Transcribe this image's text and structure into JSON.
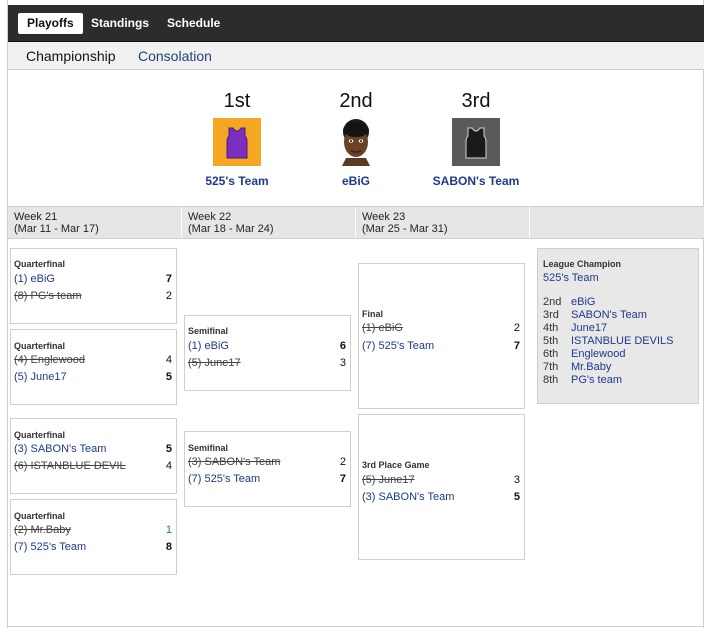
{
  "topnav": {
    "tabs": [
      "Playoffs",
      "Standings",
      "Schedule"
    ],
    "active": 0
  },
  "subnav": {
    "tabs": [
      "Championship",
      "Consolation"
    ],
    "active": 0
  },
  "podium": [
    {
      "place": "1st",
      "team": "525's Team",
      "icon": "purple-jersey-icon",
      "color": "#7b2fbf"
    },
    {
      "place": "2nd",
      "team": "eBiG",
      "icon": "player-portrait-icon",
      "color": "#5a3a22"
    },
    {
      "place": "3rd",
      "team": "SABON's Team",
      "icon": "black-jersey-icon",
      "color": "#1a1a1a"
    }
  ],
  "weeks": [
    {
      "week": "Week 21",
      "dates": "(Mar 11 - Mar 17)"
    },
    {
      "week": "Week 22",
      "dates": "(Mar 18 - Mar 24)"
    },
    {
      "week": "Week 23",
      "dates": "(Mar 25 - Mar 31)"
    }
  ],
  "bracket": {
    "quarterfinals": [
      {
        "round": "Quarterfinal",
        "a": {
          "team": "(1) eBiG",
          "score": "7",
          "lost": false
        },
        "b": {
          "team": "(8) PG's team",
          "score": "2",
          "lost": true
        }
      },
      {
        "round": "Quarterfinal",
        "a": {
          "team": "(4) Englewood",
          "score": "4",
          "lost": true
        },
        "b": {
          "team": "(5) June17",
          "score": "5",
          "lost": false
        }
      },
      {
        "round": "Quarterfinal",
        "a": {
          "team": "(3) SABON's Team",
          "score": "5",
          "lost": false
        },
        "b": {
          "team": "(6) ISTANBLUE DEVIL",
          "score": "4",
          "lost": true
        }
      },
      {
        "round": "Quarterfinal",
        "a": {
          "team": "(2) Mr.Baby",
          "score": "1",
          "lost": true
        },
        "b": {
          "team": "(7) 525's Team",
          "score": "8",
          "lost": false
        }
      }
    ],
    "semifinals": [
      {
        "round": "Semifinal",
        "a": {
          "team": "(1) eBiG",
          "score": "6",
          "lost": false
        },
        "b": {
          "team": "(5) June17",
          "score": "3",
          "lost": true
        }
      },
      {
        "round": "Semifinal",
        "a": {
          "team": "(3) SABON's Team",
          "score": "2",
          "lost": true
        },
        "b": {
          "team": "(7) 525's Team",
          "score": "7",
          "lost": false
        }
      }
    ],
    "final": {
      "round": "Final",
      "a": {
        "team": "(1) eBiG",
        "score": "2",
        "lost": true
      },
      "b": {
        "team": "(7) 525's Team",
        "score": "7",
        "lost": false
      }
    },
    "third": {
      "round": "3rd Place Game",
      "a": {
        "team": "(5) June17",
        "score": "3",
        "lost": true
      },
      "b": {
        "team": "(3) SABON's Team",
        "score": "5",
        "lost": false
      }
    }
  },
  "champion": {
    "title": "League Champion",
    "team": "525's Team",
    "standings": [
      {
        "rank": "2nd",
        "team": "eBiG"
      },
      {
        "rank": "3rd",
        "team": "SABON's Team"
      },
      {
        "rank": "4th",
        "team": "June17"
      },
      {
        "rank": "5th",
        "team": "ISTANBLUE DEVILS"
      },
      {
        "rank": "6th",
        "team": "Englewood"
      },
      {
        "rank": "7th",
        "team": "Mr.Baby"
      },
      {
        "rank": "8th",
        "team": "PG's team"
      }
    ]
  }
}
